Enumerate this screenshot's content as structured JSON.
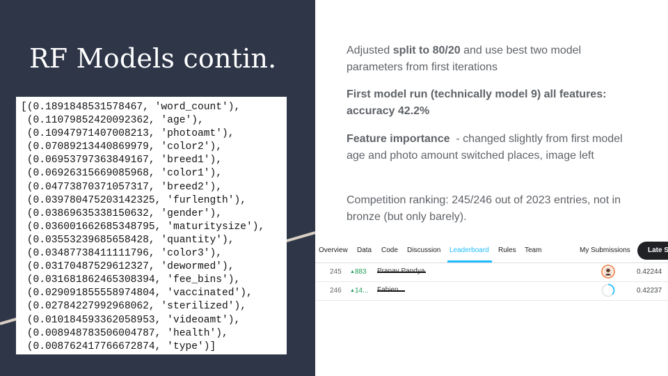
{
  "slide": {
    "title": "RF Models contin."
  },
  "code_output": [
    "[(0.1891848531578467, 'word_count'),",
    " (0.11079852420092362, 'age'),",
    " (0.10947971407008213, 'photoamt'),",
    " (0.07089213440869979, 'color2'),",
    " (0.06953797363849167, 'breed1'),",
    " (0.06926315669085968, 'color1'),",
    " (0.04773870371057317, 'breed2'),",
    " (0.039780475203142325, 'furlength'),",
    " (0.03869635338150632, 'gender'),",
    " (0.036001662685348795, 'maturitysize'),",
    " (0.03553239685658428, 'quantity'),",
    " (0.03487738411111796, 'color3'),",
    " (0.03170487529612327, 'dewormed'),",
    " (0.031681862465308394, 'fee_bins'),",
    " (0.029091855558974804, 'vaccinated'),",
    " (0.02784227992968062, 'sterilized'),",
    " (0.010184593362058953, 'videoamt'),",
    " (0.008948783506004787, 'health'),",
    " (0.008762417766672874, 'type')]"
  ],
  "notes": {
    "p1_pre": "Adjusted ",
    "p1_bold": "split to 80/20",
    "p1_post": " and use best two model parameters from first iterations",
    "p2": "First model run (technically model 9) all features: accuracy 42.2%",
    "p3_bold": "Feature importance",
    "p3_post": "  - changed slightly from first model age and photo amount switched places, image left",
    "p4": "Competition ranking: 245/246 out of 2023 entries, not in bronze (but only barely)."
  },
  "leaderboard": {
    "tabs": [
      "Overview",
      "Data",
      "Code",
      "Discussion",
      "Leaderboard",
      "Rules",
      "Team"
    ],
    "active_tab": "Leaderboard",
    "my_submissions": "My Submissions",
    "late_button": "Late S",
    "rows": [
      {
        "rank": "245",
        "delta": "883",
        "team": "Pranav Pandya",
        "score": "0.42244"
      },
      {
        "rank": "246",
        "delta": "14...",
        "team": "Fabien",
        "score": "0.42237"
      }
    ]
  },
  "colors": {
    "panel_bg": "#2e3648",
    "accent_line": "#d9cfc4",
    "kaggle_blue": "#20beff",
    "up_green": "#1f9d55"
  }
}
